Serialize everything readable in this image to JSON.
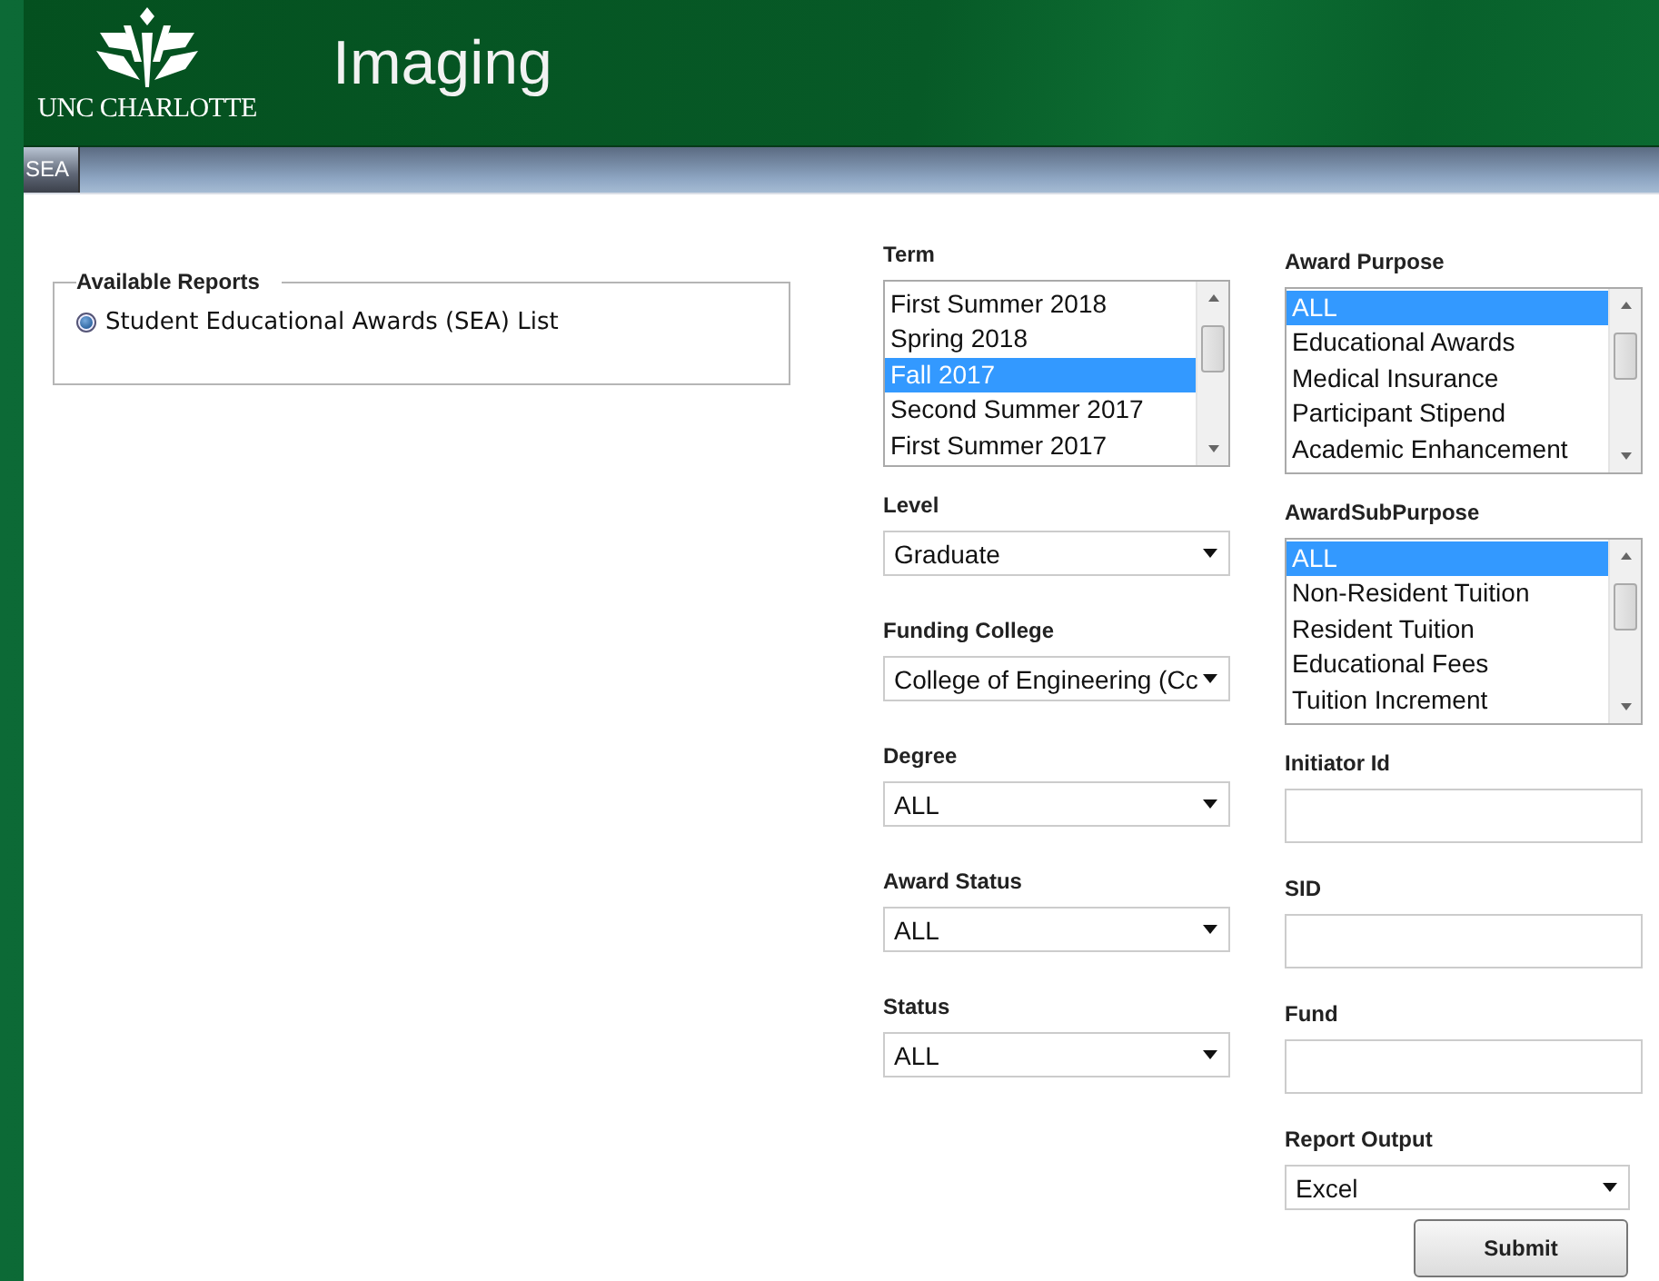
{
  "header": {
    "logo_text": "UNC CHARLOTTE",
    "title": "Imaging"
  },
  "nav_tabs": [
    {
      "label": "SEA",
      "selected": true
    }
  ],
  "available_reports": {
    "legend": "Available Reports",
    "options": [
      {
        "label": "Student Educational Awards (SEA) List",
        "selected": true
      }
    ]
  },
  "columns": [
    {
      "fields": [
        {
          "kind": "listbox",
          "label": "Term",
          "items": [
            {
              "text": "First Summer 2018",
              "selected": false
            },
            {
              "text": "Spring 2018",
              "selected": false
            },
            {
              "text": "Fall 2017",
              "selected": true
            },
            {
              "text": "Second Summer 2017",
              "selected": false
            },
            {
              "text": "First Summer 2017",
              "selected": false
            }
          ]
        },
        {
          "kind": "select",
          "label": "Level",
          "value": "Graduate"
        },
        {
          "kind": "select",
          "label": "Funding College",
          "value": "College of Engineering (Cc"
        },
        {
          "kind": "select",
          "label": "Degree",
          "value": "ALL"
        },
        {
          "kind": "select",
          "label": "Award Status",
          "value": "ALL"
        },
        {
          "kind": "select",
          "label": "Status",
          "value": "ALL"
        }
      ]
    },
    {
      "fields": [
        {
          "kind": "listbox",
          "label": "Award Purpose",
          "items": [
            {
              "text": "ALL",
              "selected": true
            },
            {
              "text": "Educational Awards",
              "selected": false
            },
            {
              "text": "Medical Insurance",
              "selected": false
            },
            {
              "text": "Participant Stipend",
              "selected": false
            },
            {
              "text": "Academic Enhancement",
              "selected": false
            }
          ]
        },
        {
          "kind": "listbox",
          "label": "AwardSubPurpose",
          "items": [
            {
              "text": "ALL",
              "selected": true
            },
            {
              "text": "Non-Resident Tuition",
              "selected": false
            },
            {
              "text": "Resident Tuition",
              "selected": false
            },
            {
              "text": "Educational Fees",
              "selected": false
            },
            {
              "text": "Tuition Increment",
              "selected": false
            }
          ]
        },
        {
          "kind": "text",
          "label": "Initiator Id"
        },
        {
          "kind": "text",
          "label": "SID"
        },
        {
          "kind": "text",
          "label": "Fund"
        },
        {
          "kind": "select",
          "label": "Report Output",
          "value": "Excel"
        }
      ]
    }
  ],
  "submit_button": {
    "label": "Submit"
  }
}
